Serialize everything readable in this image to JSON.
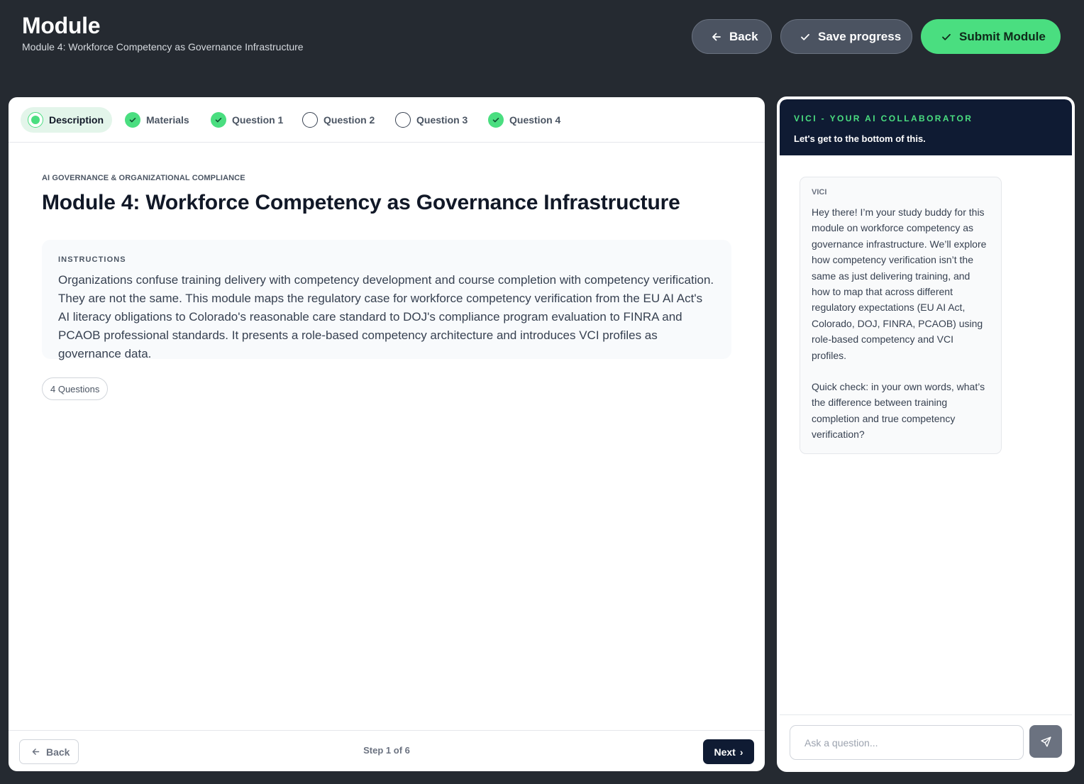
{
  "header": {
    "title": "Module",
    "subtitle": "Module 4: Workforce Competency as Governance Infrastructure",
    "back_label": "Back",
    "save_label": "Save progress",
    "submit_label": "Submit Module"
  },
  "steps": [
    {
      "label": "Description",
      "state": "active"
    },
    {
      "label": "Materials",
      "state": "complete"
    },
    {
      "label": "Question 1",
      "state": "complete"
    },
    {
      "label": "Question 2",
      "state": "incomplete"
    },
    {
      "label": "Question 3",
      "state": "incomplete"
    },
    {
      "label": "Question 4",
      "state": "complete"
    }
  ],
  "content": {
    "eyebrow": "AI GOVERNANCE & ORGANIZATIONAL COMPLIANCE",
    "title": "Module 4: Workforce Competency as Governance Infrastructure",
    "instructions_label": "INSTRUCTIONS",
    "instructions_text": "Organizations confuse training delivery with competency development and course completion with competency verification. They are not the same. This module maps the regulatory case for workforce competency verification from the EU AI Act's AI literacy obligations to Colorado's reasonable care standard to DOJ's compliance program evaluation to FINRA and PCAOB professional standards. It presents a role-based competency architecture and introduces VCI profiles as governance data.",
    "question_count": "4 Questions"
  },
  "footer": {
    "back_label": "Back",
    "step_indicator": "Step 1 of 6",
    "next_label": "Next",
    "next_glyph": "›"
  },
  "chat": {
    "eyebrow": "VICI - YOUR AI COLLABORATOR",
    "tagline": "Let's get to the bottom of this.",
    "messages": [
      {
        "sender": "VICI",
        "paragraph_1": "Hey there! I’m your study buddy for this module on workforce competency as governance infrastructure. We’ll explore how competency verification isn’t the same as just delivering training, and how to map that across different regulatory expectations (EU AI Act, Colorado, DOJ, FINRA, PCAOB) using role-based competency and VCI profiles.",
        "paragraph_2": "Quick check: in your own words, what’s the difference between training completion and true competency verification?"
      }
    ],
    "input_placeholder": "Ask a question...",
    "input_value": ""
  },
  "colors": {
    "background": "#252a31",
    "accent_green": "#4ade80",
    "navy": "#0f1b33"
  },
  "icons": {
    "back": "arrow-left-icon",
    "save": "check-icon",
    "submit": "check-icon",
    "step_complete": "check-circle-icon",
    "step_incomplete": "empty-circle-icon",
    "step_active": "radio-dot-icon",
    "send": "paper-plane-icon"
  }
}
